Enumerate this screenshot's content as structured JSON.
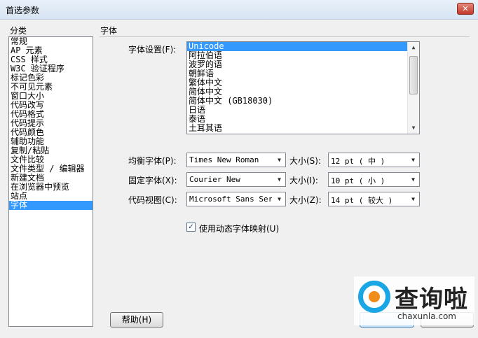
{
  "window": {
    "title": "首选参数",
    "close_glyph": "✕"
  },
  "sidebar": {
    "heading": "分类",
    "items": [
      "常规",
      "AP 元素",
      "CSS 样式",
      "W3C 验证程序",
      "标记色彩",
      "不可见元素",
      "窗口大小",
      "代码改写",
      "代码格式",
      "代码提示",
      "代码颜色",
      "辅助功能",
      "复制/粘贴",
      "文件比较",
      "文件类型 / 编辑器",
      "新建文档",
      "在浏览器中预览",
      "站点",
      "字体"
    ],
    "selected_index": 18
  },
  "panel": {
    "heading": "字体",
    "encoding": {
      "label": "字体设置(F):",
      "items": [
        "Unicode",
        "阿拉伯语",
        "波罗的语",
        "朝鲜语",
        "繁体中文",
        "简体中文",
        "简体中文 (GB18030)",
        "日语",
        "泰语",
        "土耳其语"
      ],
      "selected_index": 0
    },
    "fonts": [
      {
        "label": "均衡字体(P):",
        "face": "Times New Roman",
        "size_label": "大小(S):",
        "size": "12 pt  ( 中 )"
      },
      {
        "label": "固定字体(X):",
        "face": "Courier New",
        "size_label": "大小(I):",
        "size": "10 pt  ( 小 )"
      },
      {
        "label": "代码视图(C):",
        "face": "Microsoft Sans Serif",
        "size_label": "大小(Z):",
        "size": "14 pt  ( 较大 )"
      }
    ],
    "dynamic_mapping": {
      "label": "使用动态字体映射(U)",
      "checked": true,
      "check_glyph": "✓"
    }
  },
  "buttons": {
    "help": "帮助(H)"
  },
  "watermark": {
    "text": "查询啦",
    "url": "chaxunla.com"
  },
  "icons": {
    "close": "close-icon",
    "dropdown": "chevron-down-icon",
    "scroll_up": "scroll-up-icon",
    "scroll_down": "scroll-down-icon",
    "check": "check-icon",
    "logo": "search-logo-icon"
  },
  "colors": {
    "selection": "#3399ff",
    "title_gradient_top": "#e9f1fa",
    "close_button": "#c2382a",
    "watermark_blue": "#1aa6e4",
    "watermark_orange": "#f08c1a"
  }
}
